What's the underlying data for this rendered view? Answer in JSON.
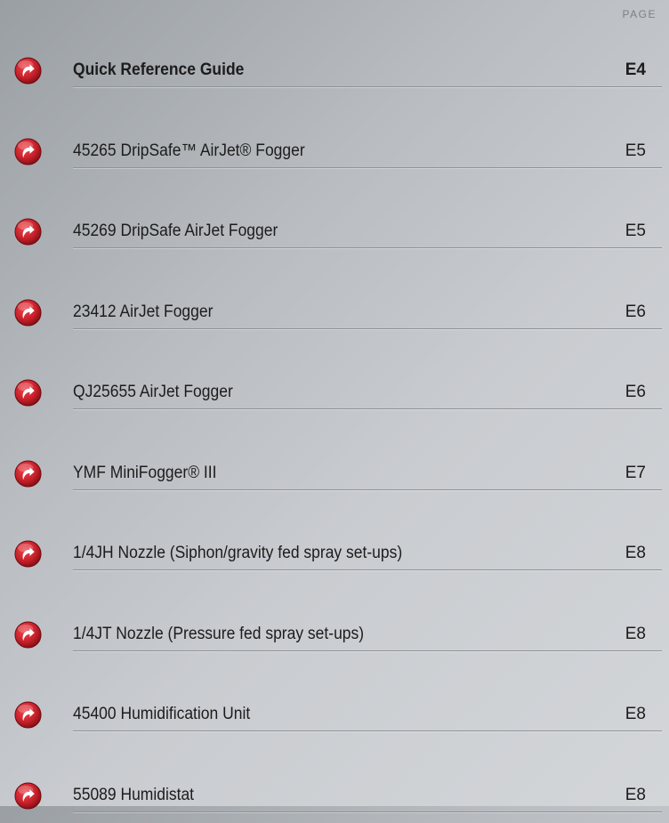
{
  "header": {
    "page_label": "PAGE"
  },
  "items": [
    {
      "title": "Quick Reference Guide",
      "page": "E4",
      "bold": true
    },
    {
      "title": "45265 DripSafe™ AirJet® Fogger",
      "page": "E5",
      "bold": false
    },
    {
      "title": "45269 DripSafe AirJet Fogger",
      "page": "E5",
      "bold": false
    },
    {
      "title": "23412 AirJet Fogger",
      "page": "E6",
      "bold": false
    },
    {
      "title": "QJ25655 AirJet Fogger",
      "page": "E6",
      "bold": false
    },
    {
      "title": "YMF MiniFogger® III",
      "page": "E7",
      "bold": false
    },
    {
      "title": "1/4JH Nozzle (Siphon/gravity fed spray set-ups)",
      "page": "E8",
      "bold": false
    },
    {
      "title": "1/4JT Nozzle (Pressure fed spray set-ups)",
      "page": "E8",
      "bold": false
    },
    {
      "title": "45400 Humidification Unit",
      "page": "E8",
      "bold": false
    },
    {
      "title": "55089 Humidistat",
      "page": "E8",
      "bold": false
    }
  ],
  "colors": {
    "icon_red": "#c8202a",
    "icon_dark_red": "#7a0d12"
  },
  "icon": "red-circular-arrow-icon"
}
